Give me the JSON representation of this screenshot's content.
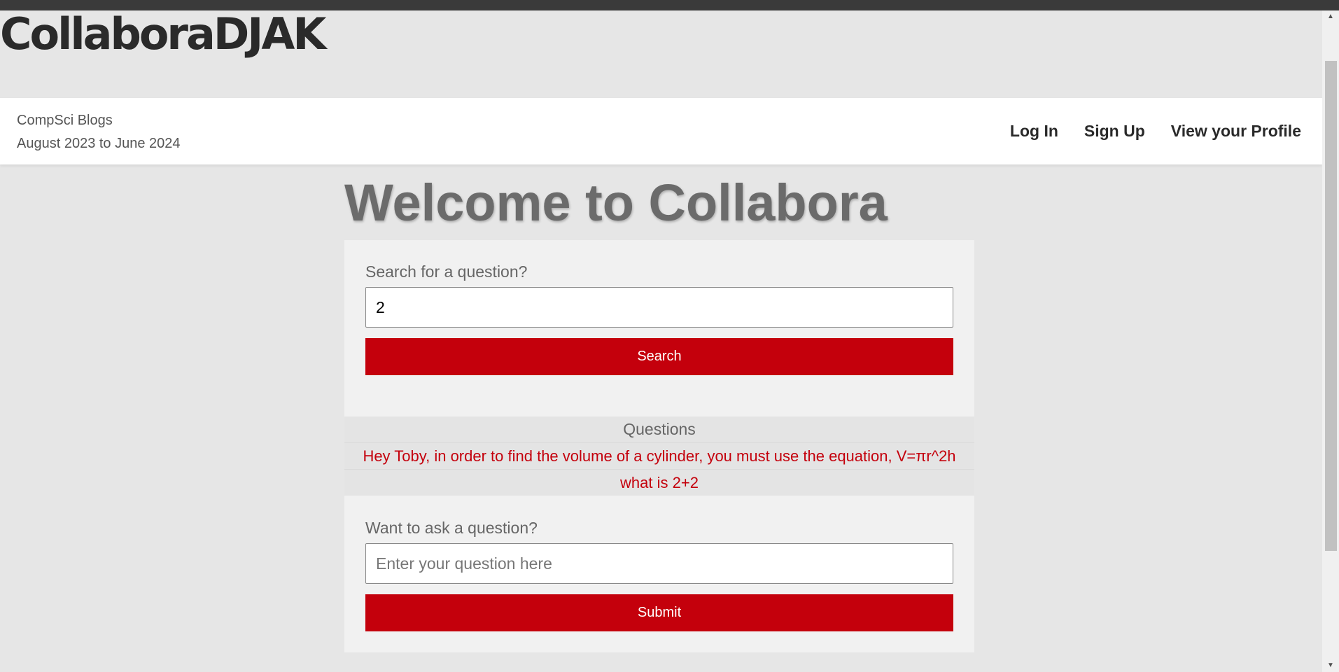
{
  "site": {
    "title": "CollaboraDJAK"
  },
  "navbar": {
    "brand_line1": "CompSci Blogs",
    "brand_line2": "August 2023 to June 2024",
    "links": [
      "Log In",
      "Sign Up",
      "View your Profile"
    ]
  },
  "main": {
    "heading": "Welcome to Collabora",
    "search": {
      "label": "Search for a question?",
      "value": "2",
      "button": "Search"
    },
    "questions": {
      "heading": "Questions",
      "items": [
        "Hey Toby, in order to find the volume of a cylinder, you must use the equation, V=πr^2h",
        "what is 2+2"
      ]
    },
    "ask": {
      "label": "Want to ask a question?",
      "placeholder": "Enter your question here",
      "button": "Submit"
    }
  },
  "colors": {
    "accent": "#c4000c",
    "background": "#e6e6e6",
    "navbar": "#ffffff",
    "title": "#2a2a2a"
  },
  "icons": {
    "scroll_up": "arrow-up-icon",
    "scroll_down": "arrow-down-icon"
  }
}
